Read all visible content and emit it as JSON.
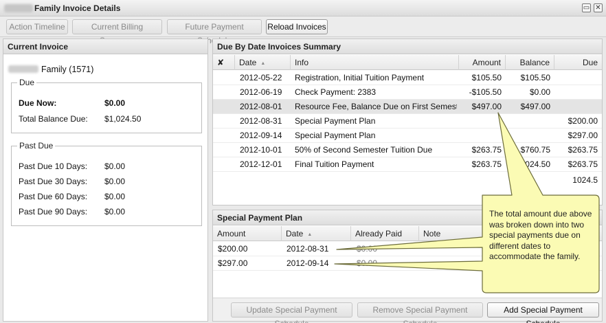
{
  "window": {
    "title": "Family Invoice Details"
  },
  "toolbar": {
    "buttons": [
      {
        "label": "Action Timeline"
      },
      {
        "label": "Current Billing Summary"
      },
      {
        "label": "Future Payment Schedule"
      },
      {
        "label": "Reload Invoices"
      }
    ]
  },
  "current_invoice": {
    "header": "Current Invoice",
    "family_label": "Family (1571)",
    "due": {
      "legend": "Due",
      "due_now_label": "Due Now:",
      "due_now_value": "$0.00",
      "total_label": "Total Balance Due:",
      "total_value": "$1,024.50"
    },
    "past_due": {
      "legend": "Past Due",
      "rows": [
        {
          "label": "Past Due 10 Days:",
          "value": "$0.00"
        },
        {
          "label": "Past Due 30 Days:",
          "value": "$0.00"
        },
        {
          "label": "Past Due 60 Days:",
          "value": "$0.00"
        },
        {
          "label": "Past Due 90 Days:",
          "value": "$0.00"
        }
      ]
    }
  },
  "summary": {
    "header": "Due By Date Invoices Summary",
    "columns": {
      "x": "✘",
      "date": "Date",
      "info": "Info",
      "amount": "Amount",
      "balance": "Balance",
      "due": "Due"
    },
    "rows": [
      {
        "date": "2012-05-22",
        "info": "Registration, Initial Tuition Payment",
        "amount": "$105.50",
        "balance": "$105.50",
        "due": ""
      },
      {
        "date": "2012-06-19",
        "info": "Check Payment: 2383",
        "amount": "-$105.50",
        "balance": "$0.00",
        "due": ""
      },
      {
        "date": "2012-08-01",
        "info": "Resource Fee, Balance Due on First Semester...",
        "amount": "$497.00",
        "balance": "$497.00",
        "due": ""
      },
      {
        "date": "2012-08-31",
        "info": "Special Payment Plan",
        "amount": "",
        "balance": "",
        "due": "$200.00"
      },
      {
        "date": "2012-09-14",
        "info": "Special Payment Plan",
        "amount": "",
        "balance": "",
        "due": "$297.00"
      },
      {
        "date": "2012-10-01",
        "info": "50% of Second Semester Tuition Due",
        "amount": "$263.75",
        "balance": "$760.75",
        "due": "$263.75"
      },
      {
        "date": "2012-12-01",
        "info": "Final Tuition Payment",
        "amount": "$263.75",
        "balance": "$1,024.50",
        "due": "$263.75"
      }
    ],
    "total": "1024.5"
  },
  "special_plan": {
    "header": "Special Payment Plan",
    "columns": {
      "amount": "Amount",
      "date": "Date",
      "paid": "Already Paid",
      "note": "Note"
    },
    "rows": [
      {
        "amount": "$200.00",
        "date": "2012-08-31",
        "paid": "$0.00"
      },
      {
        "amount": "$297.00",
        "date": "2012-09-14",
        "paid": "$0.00"
      }
    ],
    "buttons": [
      {
        "label": "Update Special Payment Schedule"
      },
      {
        "label": "Remove Special Payment Schedule"
      },
      {
        "label": "Add Special Payment Schedule"
      }
    ]
  },
  "callout": {
    "text": "The total amount due above was broken down into two special payments due on different dates to accommodate the family."
  }
}
